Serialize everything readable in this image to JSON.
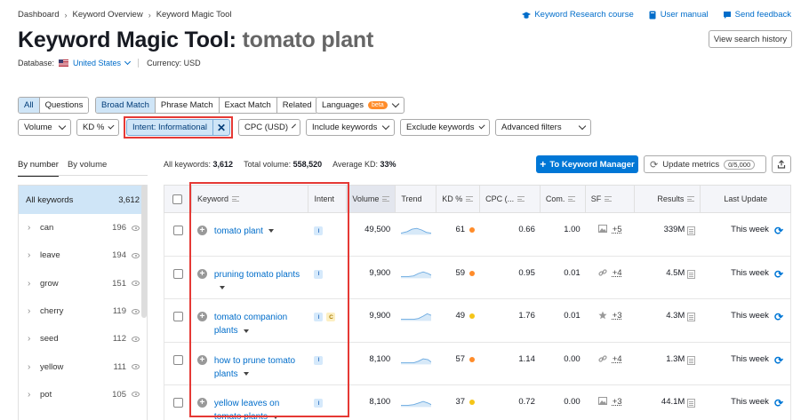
{
  "breadcrumb": [
    "Dashboard",
    "Keyword Overview",
    "Keyword Magic Tool"
  ],
  "top_links": {
    "course": "Keyword Research course",
    "manual": "User manual",
    "feedback": "Send feedback"
  },
  "title": {
    "tool": "Keyword Magic Tool:",
    "keyword": "tomato plant"
  },
  "view_history": "View search history",
  "database": {
    "label": "Database:",
    "value": "United States",
    "currency": "Currency: USD"
  },
  "match_tabs": {
    "group1": [
      "All",
      "Questions"
    ],
    "group2": [
      "Broad Match",
      "Phrase Match",
      "Exact Match",
      "Related"
    ]
  },
  "languages": {
    "label": "Languages",
    "badge": "beta"
  },
  "filters": {
    "volume": "Volume",
    "kd": "KD %",
    "intent": "Intent: Informational",
    "cpc": "CPC (USD)",
    "include": "Include keywords",
    "exclude": "Exclude keywords",
    "advanced": "Advanced filters"
  },
  "view_tabs": {
    "by_number": "By number",
    "by_volume": "By volume"
  },
  "stats": {
    "all_label": "All keywords:",
    "all_value": "3,612",
    "volume_label": "Total volume:",
    "volume_value": "558,520",
    "kd_label": "Average KD:",
    "kd_value": "33%"
  },
  "buttons": {
    "to_manager": "To Keyword Manager",
    "update_metrics": "Update metrics",
    "update_count": "0/5,000"
  },
  "sidebar": {
    "all": {
      "label": "All keywords",
      "count": "3,612"
    },
    "items": [
      {
        "label": "can",
        "count": "196"
      },
      {
        "label": "leave",
        "count": "194"
      },
      {
        "label": "grow",
        "count": "151"
      },
      {
        "label": "cherry",
        "count": "119"
      },
      {
        "label": "seed",
        "count": "112"
      },
      {
        "label": "yellow",
        "count": "111"
      },
      {
        "label": "pot",
        "count": "105"
      }
    ]
  },
  "table": {
    "headers": [
      "Keyword",
      "Intent",
      "Volume",
      "Trend",
      "KD %",
      "CPC (...",
      "Com.",
      "SF",
      "Results",
      "Last Update"
    ],
    "rows": [
      {
        "keyword": "tomato plant",
        "intent": [
          "I"
        ],
        "volume": "49,500",
        "kd": "61",
        "kd_color": "#ff8c2a",
        "cpc": "0.66",
        "com": "1.00",
        "sf_icon": "image-icon",
        "sf": "+5",
        "results": "339M",
        "update": "This week"
      },
      {
        "keyword": "pruning tomato plants",
        "intent": [
          "I"
        ],
        "volume": "9,900",
        "kd": "59",
        "kd_color": "#ff8c2a",
        "cpc": "0.95",
        "com": "0.01",
        "sf_icon": "link-icon",
        "sf": "+4",
        "results": "4.5M",
        "update": "This week"
      },
      {
        "keyword": "tomato companion plants",
        "intent": [
          "I",
          "C"
        ],
        "volume": "9,900",
        "kd": "49",
        "kd_color": "#f5c518",
        "cpc": "1.76",
        "com": "0.01",
        "sf_icon": "star-icon",
        "sf": "+3",
        "results": "4.3M",
        "update": "This week"
      },
      {
        "keyword": "how to prune tomato plants",
        "intent": [
          "I"
        ],
        "volume": "8,100",
        "kd": "57",
        "kd_color": "#ff8c2a",
        "cpc": "1.14",
        "com": "0.00",
        "sf_icon": "link-icon",
        "sf": "+4",
        "results": "1.3M",
        "update": "This week"
      },
      {
        "keyword": "yellow leaves on tomato plants",
        "intent": [
          "I"
        ],
        "volume": "8,100",
        "kd": "37",
        "kd_color": "#f5c518",
        "cpc": "0.72",
        "com": "0.00",
        "sf_icon": "image-icon",
        "sf": "+3",
        "results": "44.1M",
        "update": "This week"
      }
    ]
  },
  "colors": {
    "accent": "#0077d6",
    "highlight_box": "#e53935",
    "active_tab": "#cfe5f7"
  }
}
